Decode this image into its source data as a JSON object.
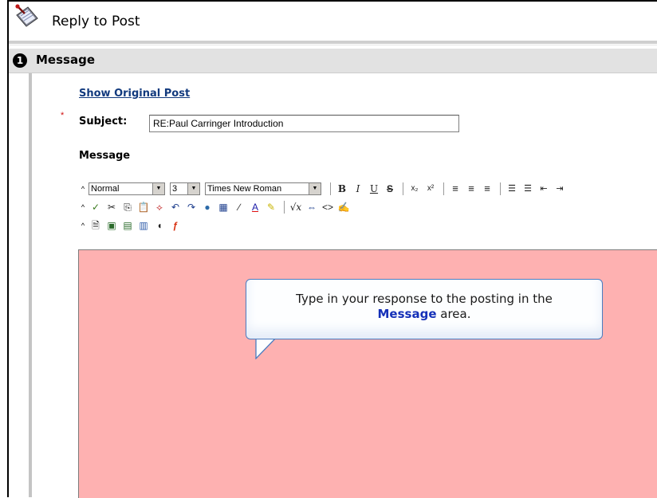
{
  "header": {
    "title": "Reply to Post",
    "icon": "quill-pen-icon"
  },
  "section": {
    "step_number": "1",
    "title": "Message"
  },
  "form": {
    "show_original_link": "Show Original Post",
    "required_marker": "*",
    "subject_label": "Subject:",
    "subject_value": "RE:Paul Carringer Introduction",
    "message_label": "Message"
  },
  "toolbar": {
    "collapse_glyph": "^",
    "style_value": "Normal",
    "size_value": "3",
    "font_value": "Times New Roman",
    "row1_buttons": [
      "bold-icon",
      "italic-icon",
      "underline-icon",
      "strikethrough-icon",
      "subscript-icon",
      "superscript-icon",
      "align-left-icon",
      "align-center-icon",
      "align-right-icon",
      "ordered-list-icon",
      "unordered-list-icon",
      "outdent-icon",
      "indent-icon"
    ],
    "row2_buttons": [
      "spellcheck-icon",
      "cut-icon",
      "copy-icon",
      "paste-icon",
      "link-break-icon",
      "undo-icon",
      "redo-icon",
      "web-link-icon",
      "table-icon",
      "pen-icon",
      "font-color-icon",
      "highlight-icon",
      "equation-icon",
      "html-arrows-icon",
      "code-icon",
      "edit-doc-icon"
    ],
    "row3_buttons": [
      "attach-file-icon",
      "image-icon",
      "media-icon",
      "document-icon",
      "audio-icon",
      "flash-icon"
    ]
  },
  "callout": {
    "text_before": "Type in your response to the posting in the",
    "emphasis": "Message",
    "text_after": "area."
  },
  "colors": {
    "editor_bg": "#feb1b1",
    "link": "#123a7e",
    "callout_border": "#4a7cc0",
    "emphasis": "#1530b8"
  }
}
